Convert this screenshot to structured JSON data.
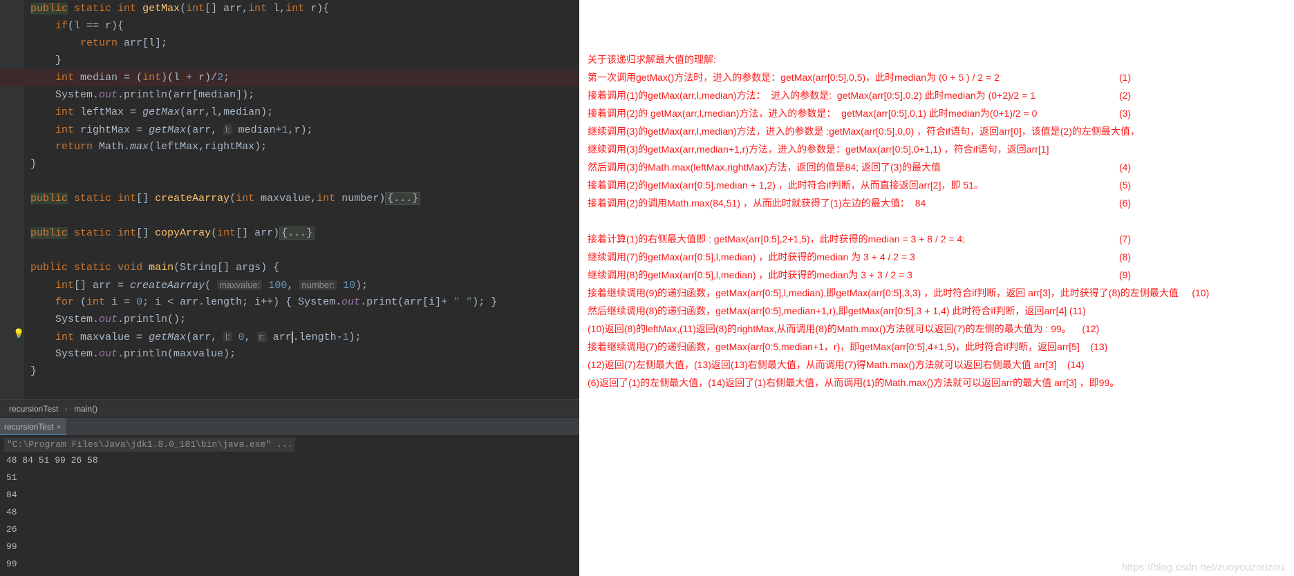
{
  "code_lines": [
    "public static int getMax(int[] arr,int l,int r){",
    "    if(l == r){",
    "        return arr[l];",
    "    }",
    "    int median = (int)(l + r)/2;",
    "    System.out.println(arr[median]);",
    "    int leftMax = getMax(arr,l,median);",
    "    int rightMax = getMax(arr, l: median+1,r);",
    "    return Math.max(leftMax,rightMax);",
    "}",
    "public static int[] createAarray(int maxvalue,int number){...}",
    "public static int[] copyArray(int[] arr){...}",
    "public static void main(String[] args) {",
    "    int[] arr = createAarray( maxvalue: 100, number: 10);",
    "    for (int i = 0; i < arr.length; i++) { System.out.print(arr[i]+ \" \"); }",
    "    System.out.println();",
    "    int maxvalue = getMax(arr, l: 0, r: arr.length-1);",
    "    System.out.println(maxvalue);",
    "}"
  ],
  "breadcrumb": {
    "file": "recursionTest",
    "method": "main()"
  },
  "run_tab": {
    "label": "recursionTest"
  },
  "console": {
    "command": "\"C:\\Program Files\\Java\\jdk1.8.0_181\\bin\\java.exe\" ...",
    "output": [
      "48 84 51 99 26 58",
      "51",
      "84",
      "48",
      "26",
      "99",
      "99"
    ]
  },
  "notes": [
    {
      "text": "关于该递归求解最大值的理解:",
      "tag": ""
    },
    {
      "text": "第一次调用getMax()方法时，进入的参数是：getMax(arr[0:5],0,5)，此时median为 (0 + 5 ) / 2 = 2",
      "tag": "(1)"
    },
    {
      "text": "接着调用(1)的getMax(arr,l,median)方法：  进入的参数是:  getMax(arr[0:5],0,2) 此时median为 (0+2)/2 = 1",
      "tag": "(2)"
    },
    {
      "text": "接着调用(2)的 getMax(arr,l,median)方法，进入的参数是：  getMax(arr[0:5],0,1) 此时median为(0+1)/2 = 0",
      "tag": "(3)"
    },
    {
      "text": "继续调用(3)的getMax(arr,l,median)方法，进入的参数是 :getMax(arr[0:5],0,0) ，符合if语句，返回arr[0]，该值是(2)的左侧最大值，",
      "tag": ""
    },
    {
      "text": "继续调用(3)的getMax(arr,median+1,r)方法，进入的参数是：getMax(arr[0:5],0+1,1) ，符合if语句，返回arr[1]",
      "tag": ""
    },
    {
      "text": "然后调用(3)的Math.max(leftMax,rightMax)方法，返回的值是84; 返回了(3)的最大值",
      "tag": "(4)"
    },
    {
      "text": "接着调用(2)的getMax(arr[0:5],median + 1,2) ，此时符合if判断，从而直接返回arr[2]，即 51。",
      "tag": "(5)"
    },
    {
      "text": "接着调用(2)的调用Math.max(84,51) ，从而此时就获得了(1)左边的最大值：  84",
      "tag": "(6)"
    },
    {
      "text": "",
      "tag": ""
    },
    {
      "text": "接着计算(1)的右侧最大值即 : getMax(arr[0:5],2+1,5)，此时获得的median = 3 + 8 / 2 = 4;",
      "tag": "(7)"
    },
    {
      "text": "继续调用(7)的getMax(arr[0:5],l,median) ，此时获得的median 为 3 + 4 / 2 = 3",
      "tag": "(8)"
    },
    {
      "text": "继续调用(8)的getMax(arr[0:5],l,median) ，此时获得的median为 3 + 3 / 2 = 3",
      "tag": "(9)"
    },
    {
      "text": "接着继续调用(9)的递归函数，getMax(arr[0:5],l,median),即getMax(arr[0:5],3,3) ，此时符合if判断，返回 arr[3]，此时获得了(8)的左侧最大值     (10)",
      "tag": ""
    },
    {
      "text": "然后继续调用(8)的递归函数，getMax(arr[0:5],median+1,r),即getMax(arr[0:5],3 + 1,4) 此时符合if判断，返回arr[4] (11)",
      "tag": ""
    },
    {
      "text": "(10)返回(8)的leftMax,(11)返回(8)的rightMax,从而调用(8)的Math.max()方法就可以返回(7)的左侧的最大值为 : 99。    (12)",
      "tag": ""
    },
    {
      "text": "接着继续调用(7)的递归函数，getMax(arr[0:5,median+1，r)，即getMax(arr[0:5],4+1,5)，此时符合if判断，返回arr[5]    (13)",
      "tag": ""
    },
    {
      "text": "(12)返回(7)左侧最大值，(13)返回(13)右侧最大值，从而调用(7)得Math.max()方法就可以返回右侧最大值 arr[3]    (14)",
      "tag": ""
    },
    {
      "text": "(6)返回了(1)的左侧最大值，(14)返回了(1)右侧最大值，从而调用(1)的Math.max()方法就可以返回arr的最大值 arr[3] ，即99。",
      "tag": ""
    }
  ],
  "watermark": "https://blog.csdn.net/zuoyouzouzou"
}
